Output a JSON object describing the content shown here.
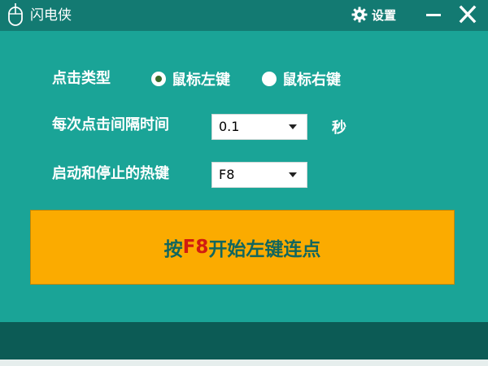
{
  "window": {
    "title": "闪电侠",
    "settings_label": "设置",
    "icons": [
      "mouse-icon",
      "gear-icon",
      "minimize-icon",
      "close-icon"
    ]
  },
  "click_type": {
    "label": "点击类型",
    "options": [
      {
        "label": "鼠标左键",
        "checked": true
      },
      {
        "label": "鼠标右键",
        "checked": false
      }
    ]
  },
  "interval": {
    "label": "每次点击间隔时间",
    "value": "0.1",
    "unit": "秒"
  },
  "hotkey": {
    "label": "启动和停止的热键",
    "value": "F8"
  },
  "start_button": {
    "prefix": "按",
    "key": "F8",
    "suffix": "开始左键连点"
  },
  "colors": {
    "background": "#1aa497",
    "titlebar": "#137a72",
    "button": "#fbab00",
    "button_text": "#12665e",
    "key_text": "#d11c10",
    "footer": "#0c5b55"
  }
}
